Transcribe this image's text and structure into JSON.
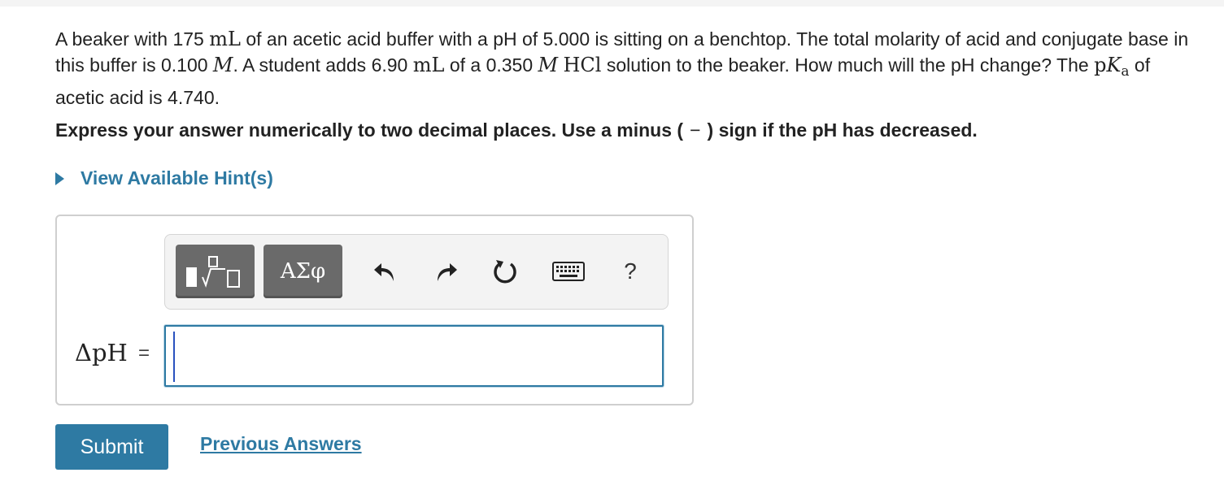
{
  "question": {
    "p1": "A beaker with 175 ",
    "u_ml": "mL",
    "p2": " of an acetic acid buffer with a pH of 5.000 is sitting on a benchtop. The total molarity of acid and conjugate base in this buffer is 0.100 ",
    "m1": "M",
    "p3": ".  A student adds 6.90 ",
    "u_ml2": "mL",
    "p4": " of a 0.350 ",
    "m2": "M",
    "hcl": "HCl",
    "p5": " solution to the beaker. How much will the pH change? The ",
    "pka_p": "p",
    "pka_k": "K",
    "pka_a": "a",
    "p6": " of acetic acid is 4.740."
  },
  "instruction": {
    "before": "Express your answer numerically to two decimal places. Use a minus (",
    "minus": "−",
    "after": ") sign if the pH has decreased."
  },
  "hint": {
    "label": "View Available Hint(s)"
  },
  "toolbar": {
    "greek_label": "ΑΣφ",
    "help_label": "?"
  },
  "answer": {
    "label": "ΔpH",
    "equals": "=",
    "value": ""
  },
  "buttons": {
    "submit": "Submit",
    "previous_answers": "Previous Answers"
  },
  "colors": {
    "accent": "#2e7aa3",
    "toolbar_button": "#6a6a6a"
  }
}
